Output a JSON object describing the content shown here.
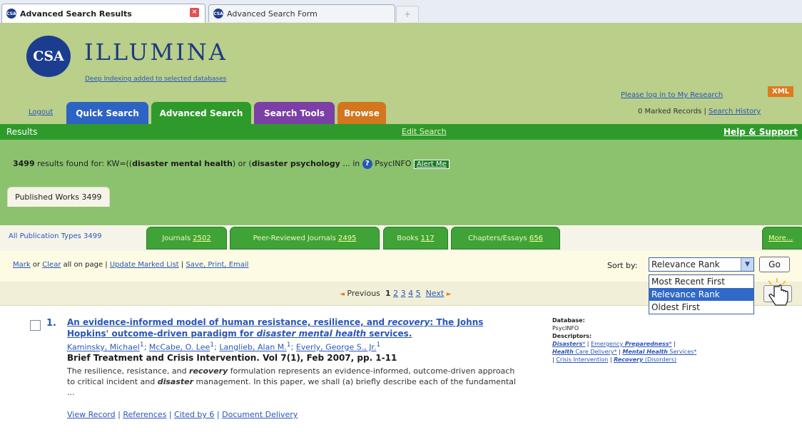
{
  "browser": {
    "tabs": [
      {
        "label": "Advanced Search Results",
        "active": true
      },
      {
        "label": "Advanced Search Form",
        "active": false
      }
    ],
    "new_tab_symbol": "+"
  },
  "header": {
    "logo_text": "CSA",
    "brand": "ILLUMINA",
    "tagline": "Deep Indexing added to selected databases",
    "login_link": "Please log in to My Research",
    "xml_badge": "XML",
    "marked_records": "0 Marked Records",
    "search_history": "Search History",
    "logout": "Logout",
    "nav_tabs": [
      {
        "label": "Quick Search",
        "color": "#2d63c2"
      },
      {
        "label": "Advanced Search",
        "color": "#2f9a2c"
      },
      {
        "label": "Search Tools",
        "color": "#7b3fa6"
      },
      {
        "label": "Browse",
        "color": "#d3761d"
      }
    ]
  },
  "results_bar": {
    "left": "Results",
    "center": "Edit Search",
    "right": "Help & Support"
  },
  "summary": {
    "count": "3499",
    "text_before": "results found for:",
    "query_prefix": "KW=((",
    "term1": "disaster mental health",
    "joiner": ") or (",
    "term2": "disaster psychology",
    "ellipsis": "... in",
    "help_symbol": "?",
    "database": "PsycINFO",
    "alert": "Alert Me"
  },
  "published_tab": "Published Works 3499",
  "filter_tabs": {
    "all": "All Publication Types 3499",
    "journals_label": "Journals",
    "journals_count": "2502",
    "peer_label": "Peer-Reviewed Journals",
    "peer_count": "2495",
    "books_label": "Books",
    "books_count": "117",
    "chapters_label": "Chapters/Essays",
    "chapters_count": "656",
    "more": "More..."
  },
  "actions": {
    "mark": "Mark",
    "or": "or",
    "clear": "Clear",
    "all_on_page": "all on page |",
    "update": "Update Marked List",
    "sep": "|",
    "save": "Save, Print, Email",
    "sort_label": "Sort by:",
    "sort_value": "Relevance Rank",
    "go": "Go",
    "sort_options": [
      {
        "label": "Most Recent First",
        "selected": false
      },
      {
        "label": "Relevance Rank",
        "selected": true
      },
      {
        "label": "Oldest First",
        "selected": false
      }
    ]
  },
  "pagination": {
    "prev_arrow": "◄",
    "previous": "Previous",
    "pages": [
      "1",
      "2",
      "3",
      "4",
      "5"
    ],
    "next": "Next",
    "next_arrow": "►"
  },
  "result": {
    "number": "1.",
    "title_a": "An evidence-informed model of human resistance, resilience, and ",
    "title_b": "recovery",
    "title_c": ": The Johns Hopkins' outcome-driven paradigm for ",
    "title_d": "disaster mental health",
    "title_e": " services.",
    "authors": [
      "Kaminsky, Michael",
      "McCabe, O. Lee",
      "Langlieb, Alan M.",
      "Everly, George S., Jr."
    ],
    "author_sup": "1",
    "source": "Brief Treatment and Crisis Intervention. Vol 7(1), Feb 2007, pp. 1-11",
    "abstract_a": "The resilience, resistance, and ",
    "abstract_b": "recovery",
    "abstract_c": " formulation represents an evidence-informed, outcome-driven approach to critical incident and ",
    "abstract_d": "disaster",
    "abstract_e": " management. In this paper, we shall (a) briefly describe each of the fundamental ...",
    "links": [
      "View Record",
      "References",
      "Cited by 6",
      "Document Delivery"
    ],
    "meta": {
      "database_label": "Database:",
      "database": "PsycINFO",
      "descriptors_label": "Descriptors:",
      "d1": "Disasters",
      "d2a": "Emergency ",
      "d2b": "Preparedness",
      "d3a": "Health",
      "d3b": " Care Delivery",
      "d4a": "Mental Health",
      "d4b": " Services",
      "d5": "Crisis Intervention",
      "d6a": "Recovery",
      "d6b": " (Disorders)",
      "star": "*"
    }
  }
}
